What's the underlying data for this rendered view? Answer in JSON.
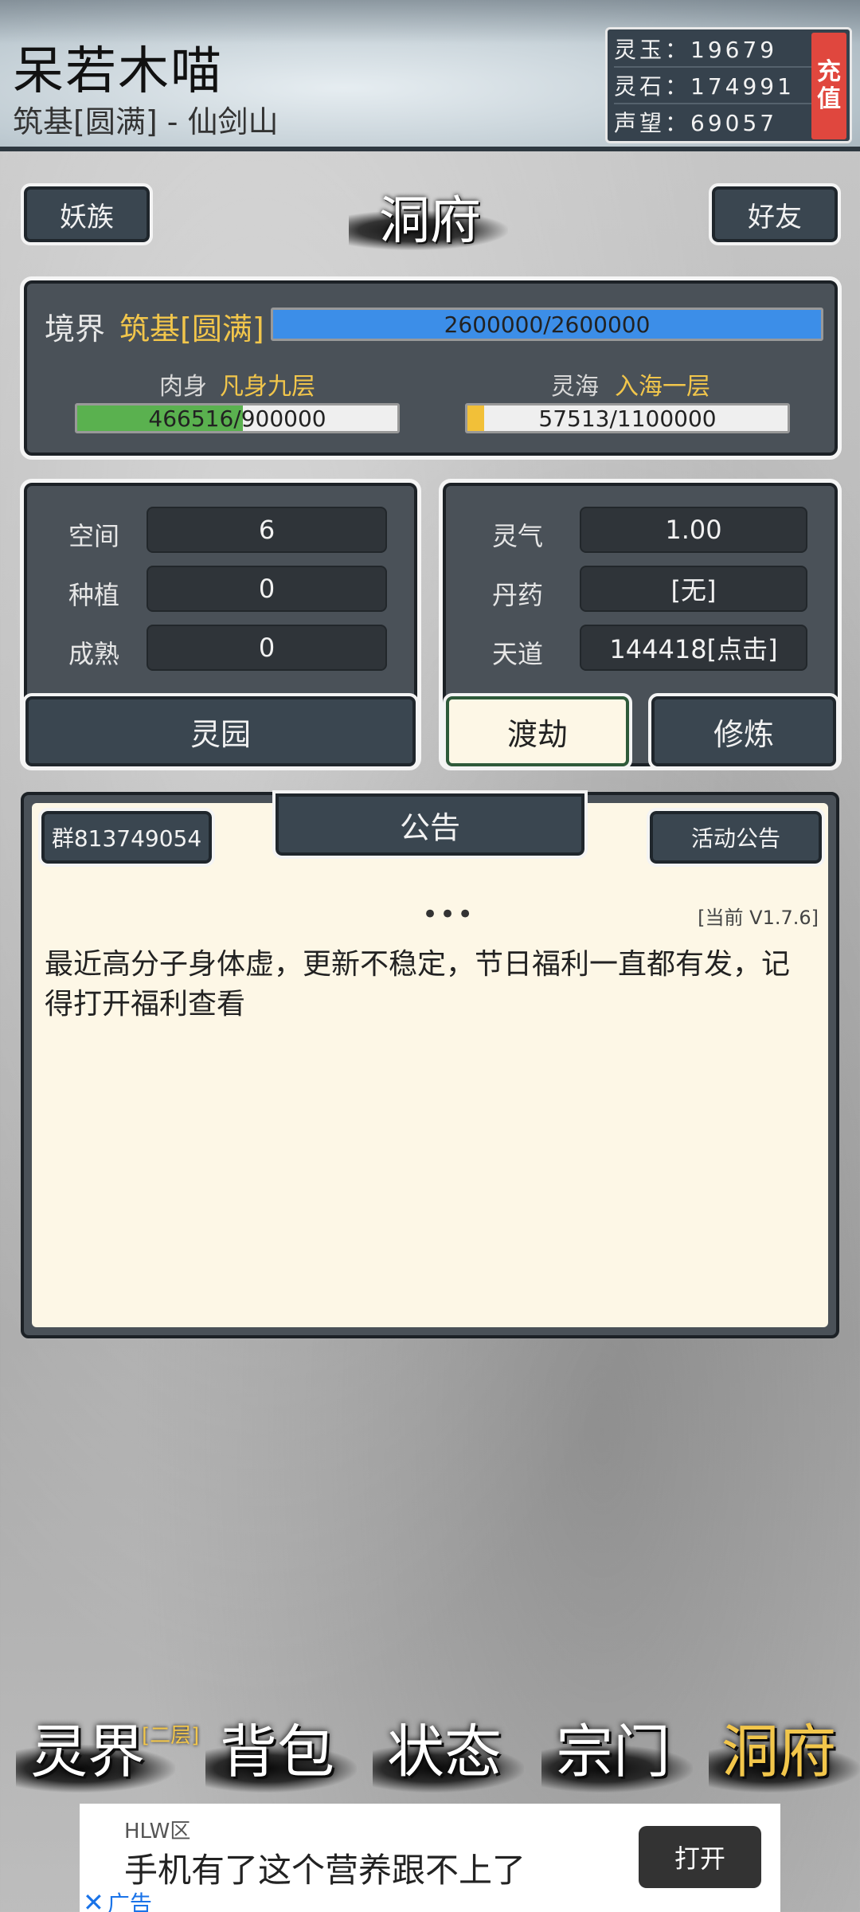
{
  "header": {
    "player_name": "呆若木喵",
    "realm_location": "筑基[圆满] - 仙剑山",
    "currencies": [
      {
        "label": "灵玉：19679"
      },
      {
        "label": "灵石：174991"
      },
      {
        "label": "声望：69057"
      }
    ],
    "recharge_label": "充值"
  },
  "top_buttons": {
    "left": "妖族",
    "title": "洞府",
    "right": "好友"
  },
  "realm_panel": {
    "realm_label": "境界",
    "realm_value": "筑基[圆满]",
    "realm_progress_text": "2600000/2600000",
    "realm_progress_fraction": 1.0,
    "body_label": "肉身",
    "body_value": "凡身九层",
    "body_progress_text": "466516/900000",
    "body_progress_fraction": 0.518,
    "sea_label": "灵海",
    "sea_value": "入海一层",
    "sea_progress_text": "57513/1100000",
    "sea_progress_fraction": 0.052,
    "colors": {
      "realm_bar": "#3c8ee8",
      "body_bar": "#5ab14f",
      "sea_bar": "#f2c038",
      "accent": "#f2c64b"
    }
  },
  "garden_panel": {
    "rows": [
      {
        "label": "空间",
        "value": "6"
      },
      {
        "label": "种植",
        "value": "0"
      },
      {
        "label": "成熟",
        "value": "0"
      }
    ],
    "button": "灵园"
  },
  "qi_panel": {
    "rows": [
      {
        "label": "灵气",
        "value": "1.00"
      },
      {
        "label": "丹药",
        "value": "[无]"
      },
      {
        "label": "天道",
        "value": "144418[点击]"
      }
    ],
    "button_tribulation": "渡劫",
    "button_cultivate": "修炼"
  },
  "notice": {
    "group_button": "群813749054",
    "tab_label": "公告",
    "activity_button": "活动公告",
    "more": "•••",
    "version": "[当前 V1.7.6]",
    "text": "最近高分子身体虚，更新不稳定，节日福利一直都有发，记得打开福利查看"
  },
  "bottom_nav": [
    {
      "label": "灵界",
      "badge": "[二层]"
    },
    {
      "label": "背包"
    },
    {
      "label": "状态"
    },
    {
      "label": "宗门"
    },
    {
      "label": "洞府",
      "active": true
    }
  ],
  "ad": {
    "brand": "HLW区",
    "headline": "手机有了这个营养跟不上了",
    "open_button": "打开",
    "tag": "广告"
  }
}
